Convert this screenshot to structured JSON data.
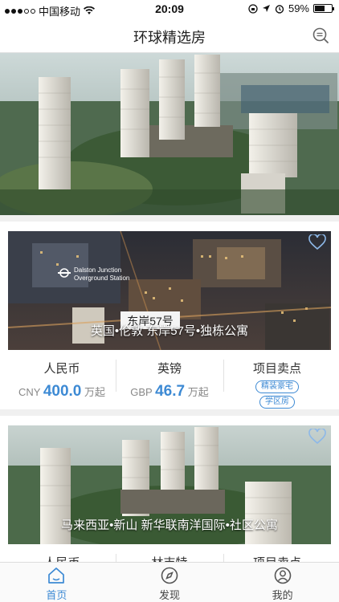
{
  "status_bar": {
    "carrier": "中国移动",
    "time": "20:09",
    "battery": "59%"
  },
  "nav": {
    "title": "环球精选房"
  },
  "cards": [
    {
      "image_sign_line1": "Dalston Junction",
      "image_sign_line2": "Overground Station",
      "image_label": "东岸57号",
      "caption": "英国•伦敦  东岸57号•独栋公寓",
      "col1_label": "人民币",
      "col1_currency": "CNY",
      "col1_value": "400.0",
      "col1_unit": "万起",
      "col2_label": "英镑",
      "col2_currency": "GBP",
      "col2_value": "46.7",
      "col2_unit": "万起",
      "col3_label": "项目卖点",
      "tags": [
        "精装豪宅",
        "学区房"
      ]
    },
    {
      "caption": "马来西亚•新山  新华联南洋国际•社区公寓",
      "col1_label": "人民币",
      "col2_label": "林吉特",
      "col3_label": "项目卖点"
    }
  ],
  "tabs": [
    {
      "label": "首页",
      "icon": "home-icon",
      "active": true
    },
    {
      "label": "发现",
      "icon": "compass-icon",
      "active": false
    },
    {
      "label": "我的",
      "icon": "user-icon",
      "active": false
    }
  ],
  "colors": {
    "accent": "#3d8ad4"
  }
}
